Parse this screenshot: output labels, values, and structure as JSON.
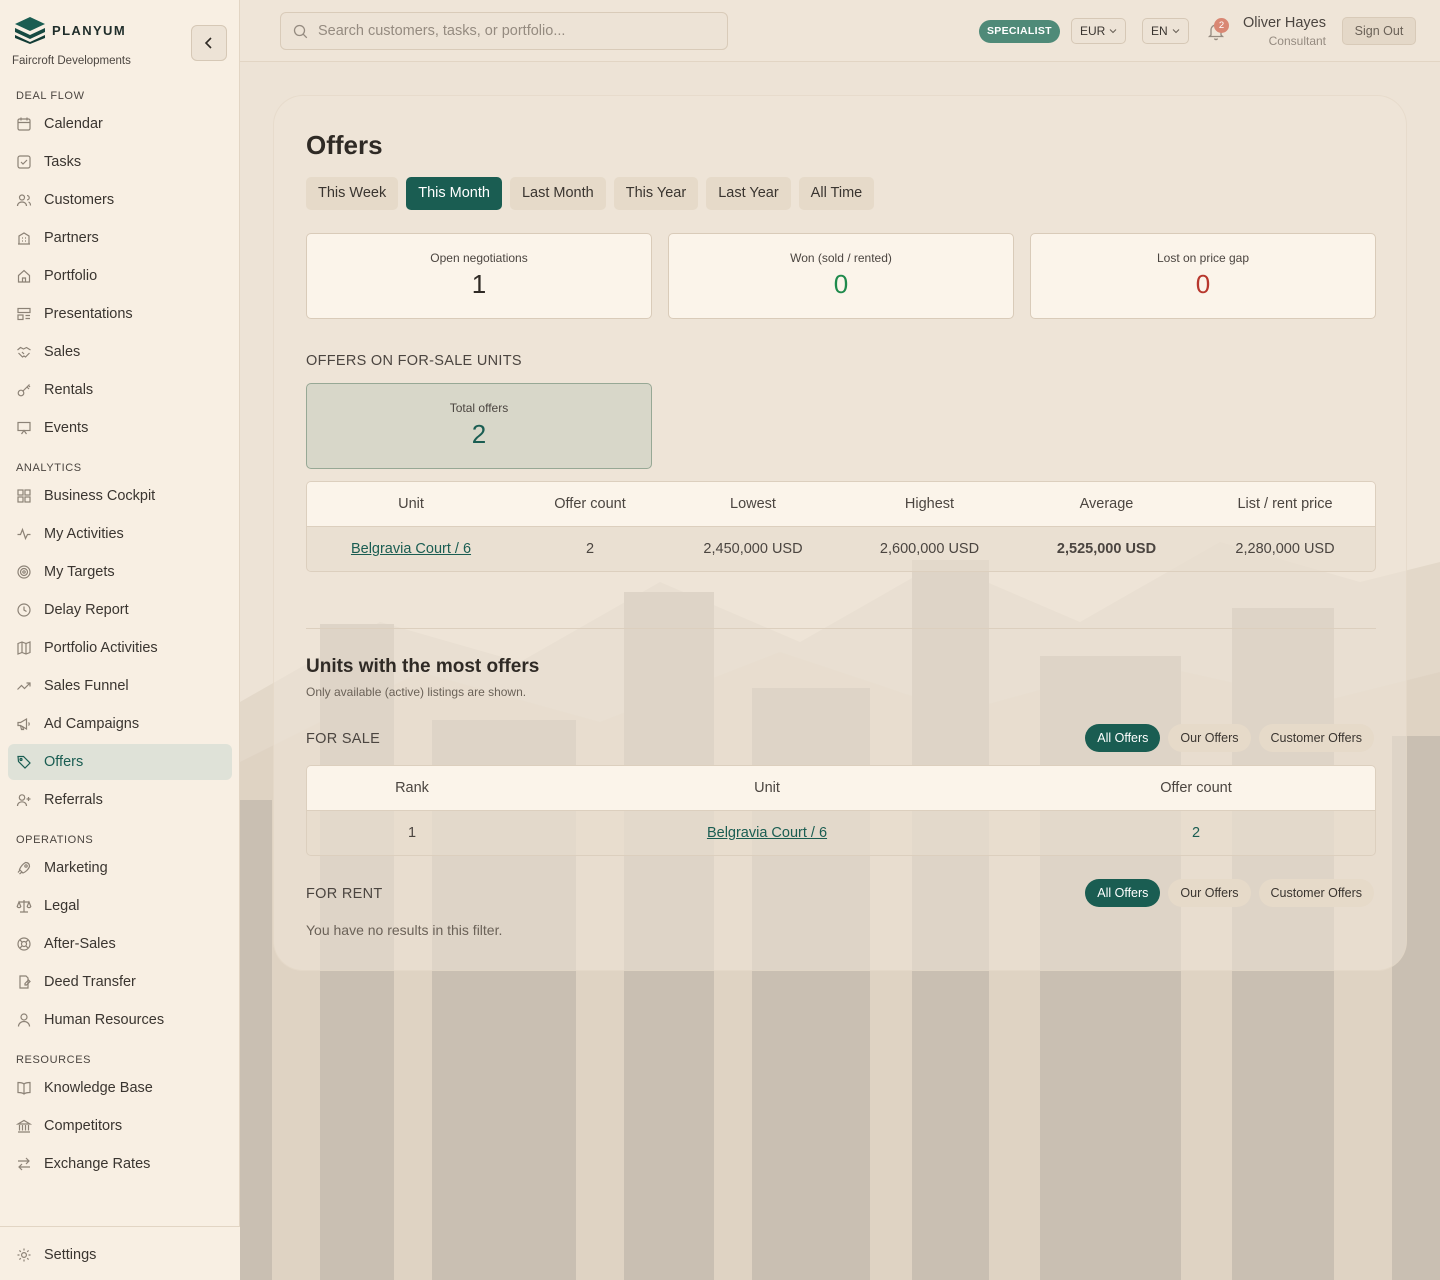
{
  "brand": {
    "name": "PLANYUM",
    "org": "Faircroft Developments"
  },
  "sidebar": {
    "sections": [
      {
        "title": "DEAL FLOW",
        "items": [
          {
            "label": "Calendar",
            "icon": "calendar-icon"
          },
          {
            "label": "Tasks",
            "icon": "task-icon"
          },
          {
            "label": "Customers",
            "icon": "users-icon"
          },
          {
            "label": "Partners",
            "icon": "building-icon"
          },
          {
            "label": "Portfolio",
            "icon": "home-icon"
          },
          {
            "label": "Presentations",
            "icon": "layout-icon"
          },
          {
            "label": "Sales",
            "icon": "handshake-icon"
          },
          {
            "label": "Rentals",
            "icon": "key-icon"
          },
          {
            "label": "Events",
            "icon": "presentation-icon"
          }
        ]
      },
      {
        "title": "ANALYTICS",
        "items": [
          {
            "label": "Business Cockpit",
            "icon": "grid-icon"
          },
          {
            "label": "My Activities",
            "icon": "activity-icon"
          },
          {
            "label": "My Targets",
            "icon": "target-icon"
          },
          {
            "label": "Delay Report",
            "icon": "clock-icon"
          },
          {
            "label": "Portfolio Activities",
            "icon": "map-icon"
          },
          {
            "label": "Sales Funnel",
            "icon": "trend-icon"
          },
          {
            "label": "Ad Campaigns",
            "icon": "megaphone-icon"
          },
          {
            "label": "Offers",
            "icon": "tag-icon",
            "active": true
          },
          {
            "label": "Referrals",
            "icon": "user-plus-icon"
          }
        ]
      },
      {
        "title": "OPERATIONS",
        "items": [
          {
            "label": "Marketing",
            "icon": "rocket-icon"
          },
          {
            "label": "Legal",
            "icon": "scale-icon"
          },
          {
            "label": "After-Sales",
            "icon": "lifebuoy-icon"
          },
          {
            "label": "Deed Transfer",
            "icon": "file-sign-icon"
          },
          {
            "label": "Human Resources",
            "icon": "user-icon"
          }
        ]
      },
      {
        "title": "RESOURCES",
        "items": [
          {
            "label": "Knowledge Base",
            "icon": "book-icon"
          },
          {
            "label": "Competitors",
            "icon": "bank-icon"
          },
          {
            "label": "Exchange Rates",
            "icon": "exchange-icon"
          }
        ]
      }
    ],
    "footer": {
      "label": "Settings",
      "icon": "gear-icon"
    }
  },
  "topbar": {
    "search_placeholder": "Search customers, tasks, or portfolio...",
    "role_badge": "SPECIALIST",
    "currency": "EUR",
    "language": "EN",
    "notification_count": "2",
    "user_name": "Oliver Hayes",
    "user_role": "Consultant",
    "signout": "Sign Out"
  },
  "offers": {
    "title": "Offers",
    "periods": [
      {
        "label": "This Week"
      },
      {
        "label": "This Month",
        "active": true
      },
      {
        "label": "Last Month"
      },
      {
        "label": "This Year"
      },
      {
        "label": "Last Year"
      },
      {
        "label": "All Time"
      }
    ],
    "stats": [
      {
        "label": "Open negotiations",
        "value": "1",
        "color": "#2f2a25"
      },
      {
        "label": "Won (sold / rented)",
        "value": "0",
        "color": "#1f8a4c"
      },
      {
        "label": "Lost on price gap",
        "value": "0",
        "color": "#b7372d"
      }
    ],
    "for_sale_section": {
      "caption": "OFFERS ON FOR-SALE UNITS",
      "total_label": "Total offers",
      "total_value": "2",
      "columns": [
        "Unit",
        "Offer count",
        "Lowest",
        "Highest",
        "Average",
        "List / rent price"
      ],
      "rows": [
        {
          "unit": "Belgravia Court / 6",
          "count": "2",
          "lowest": "2,450,000 USD",
          "highest": "2,600,000 USD",
          "average": "2,525,000 USD",
          "list": "2,280,000 USD"
        }
      ]
    },
    "most_offers": {
      "title": "Units with the most offers",
      "description": "Only available (active) listings are shown.",
      "for_sale_label": "FOR SALE",
      "for_rent_label": "FOR RENT",
      "filters": [
        "All Offers",
        "Our Offers",
        "Customer Offers"
      ],
      "columns": [
        "Rank",
        "Unit",
        "Offer count"
      ],
      "rows": [
        {
          "rank": "1",
          "unit": "Belgravia Court / 6",
          "count": "2"
        }
      ],
      "empty_text": "You have no results in this filter."
    }
  }
}
